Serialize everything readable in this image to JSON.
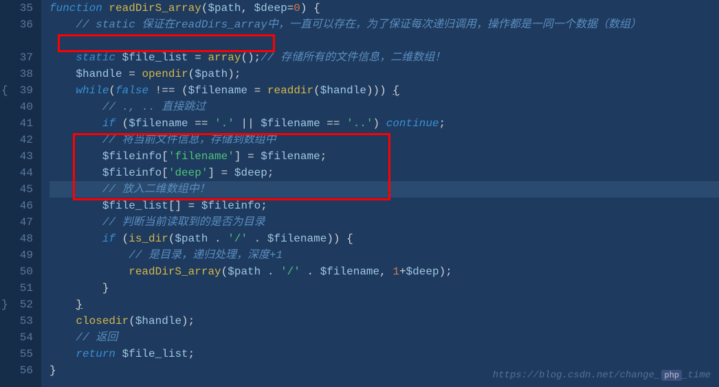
{
  "lines": {
    "start": 35,
    "end": 56
  },
  "code": {
    "l35_kw1": "function",
    "l35_fn": "readDirS_array",
    "l35_p": "(",
    "l35_v1": "$path",
    "l35_c": ", ",
    "l35_v2": "$deep",
    "l35_eq": "=",
    "l35_n": "0",
    "l35_p2": ") ",
    "l35_b": "{",
    "l36": "    // static 保证在readDirs_array中，一直可以存在，为了保证每次递归调用，操作都是一同一个数据（数组）",
    "l37_pre": "    ",
    "l37_kw": "static",
    "l37_sp": " ",
    "l37_v": "$file_list",
    "l37_eq": " = ",
    "l37_fn": "array",
    "l37_p": "();",
    "l37_cmt": "// 存储所有的文件信息，二维数组！",
    "l38_pre": "    ",
    "l38_v": "$handle",
    "l38_eq": " = ",
    "l38_fn": "opendir",
    "l38_p": "(",
    "l38_v2": "$path",
    "l38_p2": ");",
    "l39_pre": "    ",
    "l39_kw": "while",
    "l39_p": "(",
    "l39_kw2": "false",
    "l39_op": " !== ",
    "l39_p2": "(",
    "l39_v": "$filename",
    "l39_eq": " = ",
    "l39_fn": "readdir",
    "l39_p3": "(",
    "l39_v2": "$handle",
    "l39_p4": "))) ",
    "l39_b": "{",
    "l40": "        // ., .. 直接跳过",
    "l41_pre": "        ",
    "l41_kw": "if",
    "l41_p": " (",
    "l41_v": "$filename",
    "l41_op": " == ",
    "l41_s": "'.'",
    "l41_op2": " || ",
    "l41_v2": "$filename",
    "l41_op3": " == ",
    "l41_s2": "'..'",
    "l41_p2": ") ",
    "l41_kw2": "continue",
    "l41_sc": ";",
    "l42": "        // 将当前文件信息，存储到数组中",
    "l43_pre": "        ",
    "l43_v": "$fileinfo",
    "l43_p": "[",
    "l43_s": "'filename'",
    "l43_p2": "] = ",
    "l43_v2": "$filename",
    "l43_sc": ";",
    "l44_pre": "        ",
    "l44_v": "$fileinfo",
    "l44_p": "[",
    "l44_s": "'deep'",
    "l44_p2": "] = ",
    "l44_v2": "$deep",
    "l44_sc": ";",
    "l45": "        // 放入二维数组中！",
    "l46_pre": "        ",
    "l46_v": "$file_list",
    "l46_p": "[] = ",
    "l46_v2": "$fileinfo",
    "l46_sc": ";",
    "l47": "        // 判断当前读取到的是否为目录",
    "l48_pre": "        ",
    "l48_kw": "if",
    "l48_p": " (",
    "l48_fn": "is_dir",
    "l48_p2": "(",
    "l48_v": "$path",
    "l48_op": " . ",
    "l48_s": "'/'",
    "l48_op2": " . ",
    "l48_v2": "$filename",
    "l48_p3": ")) ",
    "l48_b": "{",
    "l49": "            // 是目录，递归处理，深度+1",
    "l50_pre": "            ",
    "l50_fn": "readDirS_array",
    "l50_p": "(",
    "l50_v": "$path",
    "l50_op": " . ",
    "l50_s": "'/'",
    "l50_op2": " . ",
    "l50_v2": "$filename",
    "l50_c": ", ",
    "l50_n": "1",
    "l50_op3": "+",
    "l50_v3": "$deep",
    "l50_p2": ");",
    "l51": "        }",
    "l52": "    ",
    "l52_b": "}",
    "l53_pre": "    ",
    "l53_fn": "closedir",
    "l53_p": "(",
    "l53_v": "$handle",
    "l53_p2": ");",
    "l54": "    // 返回",
    "l55_pre": "    ",
    "l55_kw": "return",
    "l55_sp": " ",
    "l55_v": "$file_list",
    "l55_sc": ";",
    "l56": "}"
  },
  "brace_markers": {
    "l39": "{",
    "l52": "}"
  },
  "watermark": {
    "text": "https://blog.csdn.net/change_",
    "badge": "php",
    "suffix": "_time"
  }
}
